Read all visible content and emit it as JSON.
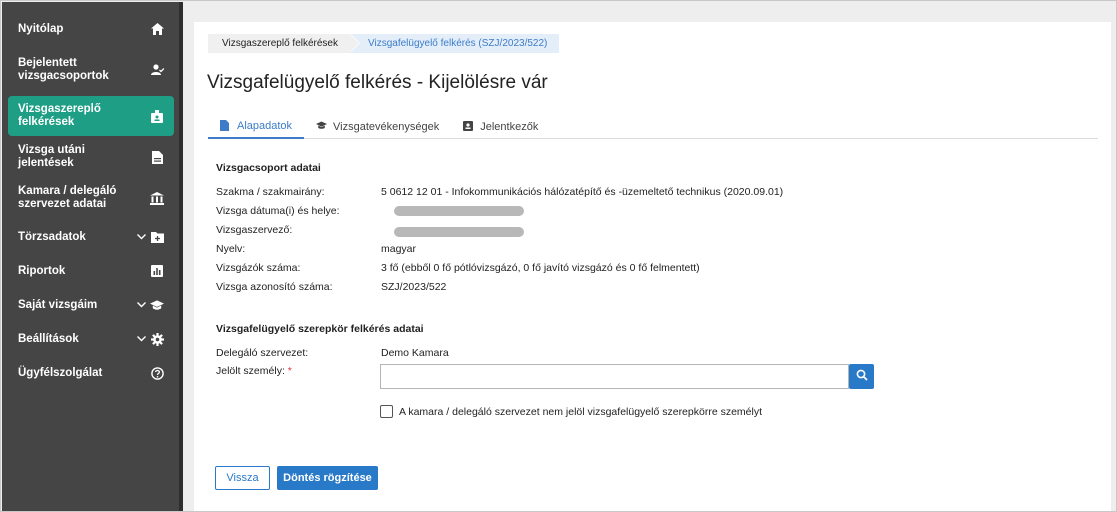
{
  "sidebar": {
    "items": [
      {
        "label": "Nyitólap",
        "icon": "home-icon"
      },
      {
        "label": "Bejelentett vizsgacsoportok",
        "icon": "user-check-icon"
      },
      {
        "label": "Vizsgaszereplő felkérések",
        "icon": "id-badge-icon",
        "active": true
      },
      {
        "label": "Vizsga utáni jelentések",
        "icon": "file-icon"
      },
      {
        "label": "Kamara / delegáló szervezet adatai",
        "icon": "institution-icon"
      },
      {
        "label": "Törzsadatok",
        "icon": "folder-icon",
        "expandable": true
      },
      {
        "label": "Riportok",
        "icon": "chart-icon"
      },
      {
        "label": "Saját vizsgáim",
        "icon": "graduation-cap-icon",
        "expandable": true
      },
      {
        "label": "Beállítások",
        "icon": "gear-icon",
        "expandable": true
      },
      {
        "label": "Ügyfélszolgálat",
        "icon": "help-icon"
      }
    ]
  },
  "breadcrumb": {
    "first": "Vizsgaszereplő felkérések",
    "current": "Vizsgafelügyelő felkérés (SZJ/2023/522)"
  },
  "page_title": "Vizsgafelügyelő felkérés - Kijelölésre vár",
  "tabs": [
    {
      "label": "Alapadatok",
      "icon": "document-icon"
    },
    {
      "label": "Vizsgatevékenységek",
      "icon": "graduation-cap-icon"
    },
    {
      "label": "Jelentkezők",
      "icon": "id-card-icon"
    }
  ],
  "group_section": {
    "title": "Vizsgacsoport adatai",
    "rows": [
      {
        "label": "Szakma / szakmairány:",
        "value": "5 0612 12 01 - Infokommunikációs hálózatépítő és -üzemeltető technikus (2020.09.01)"
      },
      {
        "label": "Vizsga dátuma(i) és helye:",
        "value": ""
      },
      {
        "label": "Vizsgaszervező:",
        "value": ""
      },
      {
        "label": "Nyelv:",
        "value": "magyar"
      },
      {
        "label": "Vizsgázók száma:",
        "value": "3 fő (ebből 0 fő pótlóvizsgázó, 0 fő javító vizsgázó és 0 fő felmentett)"
      },
      {
        "label": "Vizsga azonosító száma:",
        "value": "SZJ/2023/522"
      }
    ]
  },
  "request_section": {
    "title": "Vizsgafelügyelő szerepkör felkérés adatai",
    "delegating_label": "Delegáló szervezet:",
    "delegating_value": "Demo Kamara",
    "nominee_label": "Jelölt személy:",
    "required_mark": "*",
    "nominee_value": "",
    "checkbox_label": "A kamara / delegáló szervezet nem jelöl vizsgafelügyelő szerepkörre személyt"
  },
  "actions": {
    "back_label": "Vissza",
    "submit_label": "Döntés rögzítése"
  },
  "colors": {
    "sidebar_bg": "#454545",
    "active_item": "#1e9e85",
    "primary": "#2979c9"
  }
}
